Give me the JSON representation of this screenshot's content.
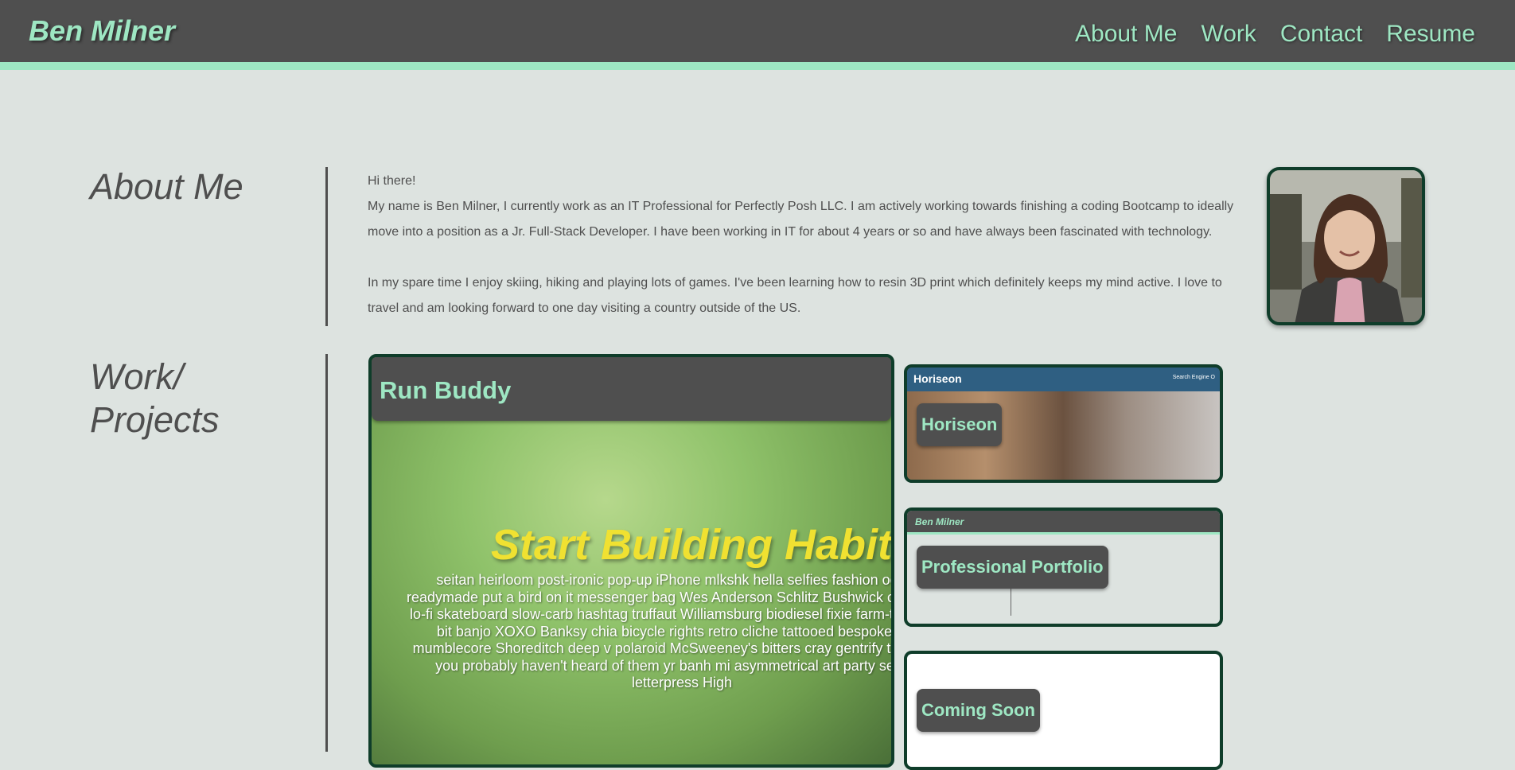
{
  "header": {
    "logo": "Ben Milner",
    "nav": [
      "About Me",
      "Work",
      "Contact",
      "Resume"
    ]
  },
  "about": {
    "title": "About Me",
    "greeting": "Hi there!",
    "paragraph1": "My name is Ben Milner, I currently work as an IT Professional for Perfectly Posh LLC. I am actively working towards finishing a coding Bootcamp to ideally move into a position as a Jr. Full-Stack Developer. I have been working in IT for about 4 years or so and have always been fascinated with technology.",
    "paragraph2": "In my spare time I enjoy skiing, hiking and playing lots of games. I've been learning how to resin 3D print which definitely keeps my mind active. I love to travel and am looking forward to one day visiting a country outside of the US."
  },
  "work": {
    "title": "Work/\nProjects",
    "projects": [
      {
        "label": "Run Buddy",
        "preview_heading": "Start Building Habits",
        "preview_body": "seitan heirloom post-ironic pop-up iPhone mlkshk hella selfies fashion occupy readymade put a bird on it messenger bag Wes Anderson Schlitz Bushwick church-key lo-fi skateboard slow-carb hashtag truffaut Williamsburg biodiesel fixie farm-to-table 8-bit banjo XOXO Banksy chia bicycle rights retro cliche tattooed bespoke irony mumblecore Shoreditch deep v polaroid McSweeney's bitters cray gentrify tofu Marfa you probably haven't heard of them yr banh mi asymmetrical art party selvage letterpress High"
      },
      {
        "label": "Horiseon",
        "preview_brand": "Horiseon",
        "preview_nav": "Search Engine O"
      },
      {
        "label": "Professional Portfolio",
        "preview_brand": "Ben Milner"
      },
      {
        "label": "Coming Soon"
      }
    ]
  },
  "colors": {
    "accent": "#9ee7c3",
    "header_bg": "#4f4f4f",
    "page_bg": "#dde3e0",
    "card_border": "#0f3d2a",
    "runbuddy_heading": "#f0e131"
  }
}
